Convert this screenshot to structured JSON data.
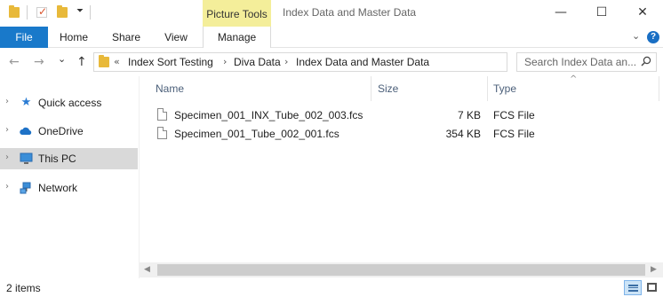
{
  "titlebar": {
    "context_tab_group": "Picture Tools",
    "window_title": "Index Data and Master Data",
    "minimize": "—",
    "maximize": "☐",
    "close": "✕"
  },
  "ribbon": {
    "tabs": [
      "File",
      "Home",
      "Share",
      "View"
    ],
    "context_tab": "Manage",
    "help": "?"
  },
  "navigation": {
    "back": "←",
    "forward": "→",
    "recent": "⌄",
    "up": "↑",
    "overflow": "«",
    "breadcrumbs": [
      "Index Sort Testing",
      "Diva Data",
      "Index Data and Master Data"
    ],
    "search_placeholder": "Search Index Data an...",
    "refresh": "↻"
  },
  "sidebar": {
    "items": [
      {
        "label": "Quick access",
        "icon": "star-icon",
        "selected": false
      },
      {
        "label": "OneDrive",
        "icon": "cloud-icon",
        "selected": false
      },
      {
        "label": "This PC",
        "icon": "computer-icon",
        "selected": true
      },
      {
        "label": "Network",
        "icon": "network-icon",
        "selected": false
      }
    ]
  },
  "file_list": {
    "columns": [
      "Name",
      "Size",
      "Type"
    ],
    "rows": [
      {
        "name": "Specimen_001_INX_Tube_002_003.fcs",
        "size": "7 KB",
        "type": "FCS File"
      },
      {
        "name": "Specimen_001_Tube_002_001.fcs",
        "size": "354 KB",
        "type": "FCS File"
      }
    ]
  },
  "statusbar": {
    "item_count": "2 items"
  },
  "colors": {
    "file_tab": "#1979ca",
    "context_tab": "#f4ee9a",
    "selected_item": "#d9d9d9",
    "column_header_text": "#4c607a"
  }
}
